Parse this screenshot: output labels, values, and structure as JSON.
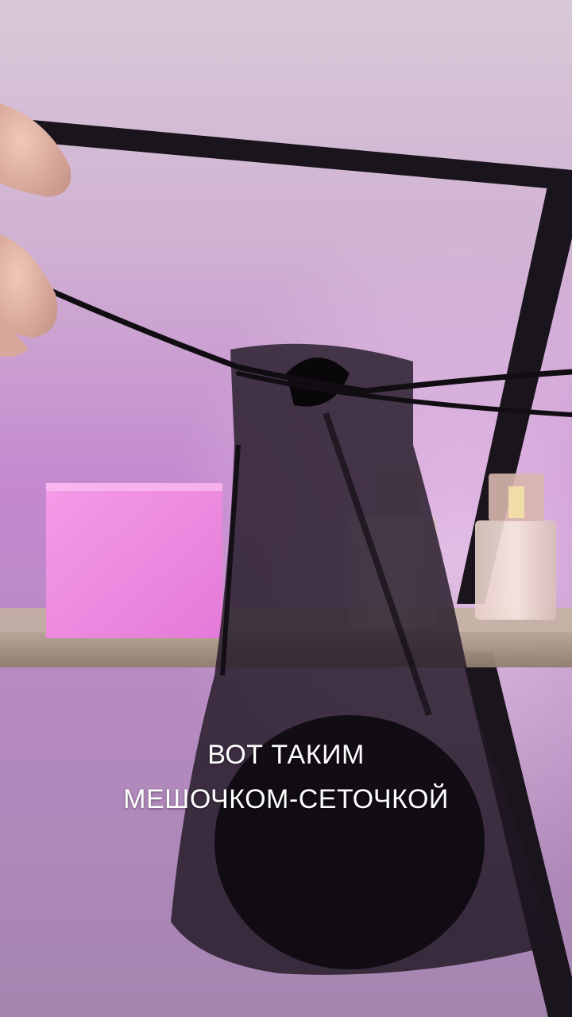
{
  "video": {
    "caption": {
      "line1": "ВОТ ТАКИМ",
      "line2": "МЕШОЧКОМ-СЕТОЧКОЙ"
    }
  }
}
